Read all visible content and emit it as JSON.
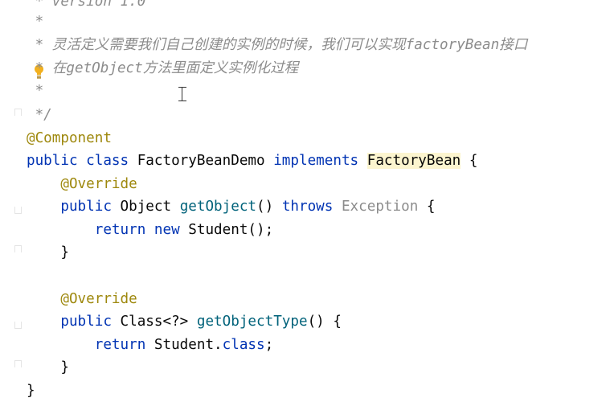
{
  "editor": {
    "icons": {
      "lightbulb": "lightbulb-icon",
      "text_cursor": "text-cursor-icon",
      "fold": "fold-marker-icon"
    },
    "colors": {
      "comment": "#8c8c8c",
      "annotation": "#9e880d",
      "keyword": "#0033b3",
      "method": "#00627a",
      "highlight": "#fcf5cf",
      "text": "#080808"
    },
    "code": {
      "l0": {
        "t": " * version 1.0"
      },
      "l1": {
        "t": " *"
      },
      "l2": {
        "star": " * ",
        "zh1": "灵活定义需要我们自己创建的实例的时候，我们可以实现",
        "word": "factoryBean",
        "zh2": "接口"
      },
      "l3": {
        "star": " * ",
        "zh1": "在",
        "word": "getObject",
        "zh2": "方法里面定义实例化过程"
      },
      "l4": {
        "t": " *"
      },
      "l5": {
        "t": " */"
      },
      "l6": {
        "t": "@Component"
      },
      "l7": {
        "kw1": "public",
        "sp1": " ",
        "kw2": "class",
        "name": " FactoryBeanDemo ",
        "kw3": "implements",
        "sp2": " ",
        "iface": "FactoryBean",
        "end": " {"
      },
      "l8": {
        "t": "    @Override"
      },
      "l9": {
        "indent": "    ",
        "kw1": "public",
        "type": " Object ",
        "fn": "getObject",
        "p": "() ",
        "kw2": "throws",
        "sp": " ",
        "exc": "Exception",
        "end": " {"
      },
      "l10": {
        "indent": "        ",
        "kw1": "return",
        "sp": " ",
        "kw2": "new",
        "rest": " Student();"
      },
      "l11": {
        "t": "    }"
      },
      "l12": {
        "t": "    @Override"
      },
      "l13": {
        "indent": "    ",
        "kw1": "public",
        "type": " Class<?> ",
        "fn": "getObjectType",
        "end": "() {"
      },
      "l14": {
        "indent": "        ",
        "kw1": "return",
        "rest": " Student.",
        "kw2": "class",
        "semi": ";"
      },
      "l15": {
        "t": "    }"
      },
      "l16": {
        "t": "}"
      }
    }
  }
}
